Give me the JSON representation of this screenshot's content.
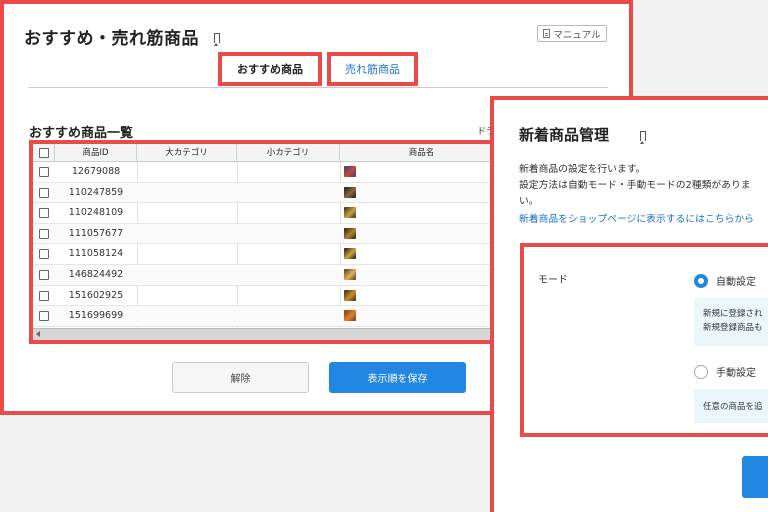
{
  "panel_recommend": {
    "title": "おすすめ・売れ筋商品",
    "manual_label": "マニュアル",
    "tabs": [
      {
        "label": "おすすめ商品",
        "active": true
      },
      {
        "label": "売れ筋商品",
        "active": false
      }
    ],
    "list_title": "おすすめ商品一覧",
    "drag_hint": "ドラ",
    "table": {
      "columns": [
        "商品ID",
        "大カテゴリ",
        "小カテゴリ",
        "商品名"
      ],
      "rows": [
        {
          "id": "12679088"
        },
        {
          "id": "110247859"
        },
        {
          "id": "110248109"
        },
        {
          "id": "111057677"
        },
        {
          "id": "111058124"
        },
        {
          "id": "146824492"
        },
        {
          "id": "151602925"
        },
        {
          "id": "151699699"
        }
      ]
    },
    "release_label": "解除",
    "save_label": "表示順を保存"
  },
  "panel_new": {
    "title": "新着商品管理",
    "desc_line1": "新着商品の設定を行います。",
    "desc_line2": "設定方法は自動モード・手動モードの2種類がありま",
    "desc_line3": "い。",
    "link_text": "新着商品をショップページに表示するにはこちらから",
    "mode_label": "モード",
    "auto_label": "自動設定",
    "auto_info_1": "新規に登録され",
    "auto_info_2": "新規登録商品も",
    "manual_mode_label": "手動設定",
    "manual_info": "任意の商品を追"
  },
  "colors": {
    "highlight": "#ec4a4a",
    "primary": "#2287e3",
    "link": "#1a73c9"
  }
}
